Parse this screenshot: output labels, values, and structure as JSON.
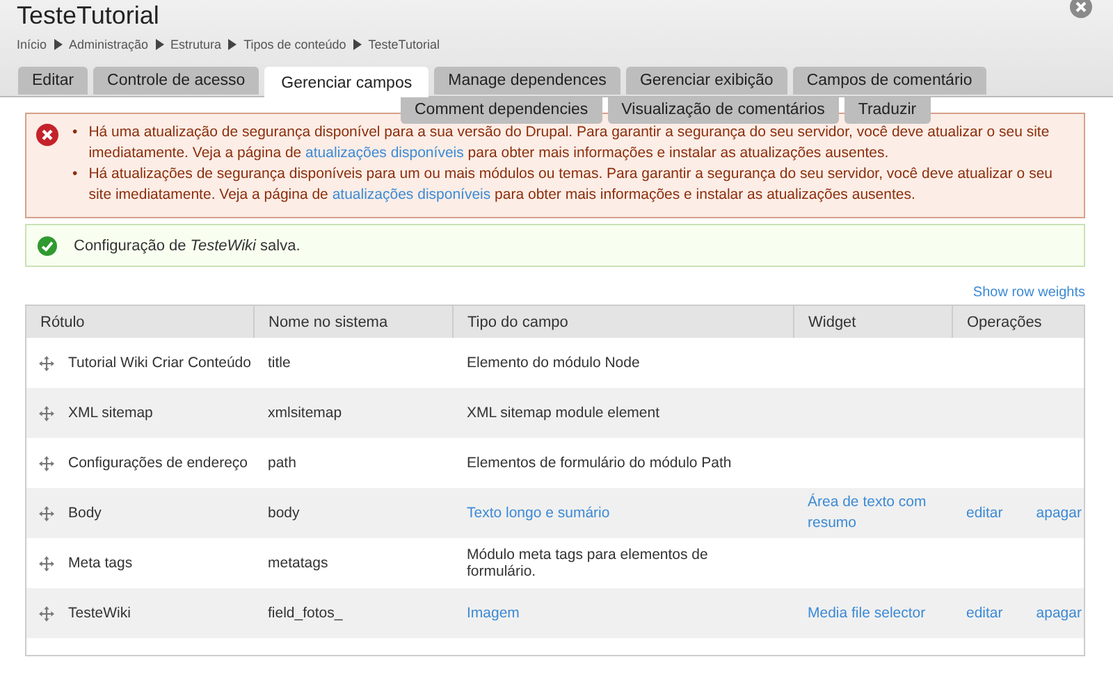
{
  "page": {
    "title": "TesteTutorial"
  },
  "breadcrumb": [
    "Início",
    "Administração",
    "Estrutura",
    "Tipos de conteúdo",
    "TesteTutorial"
  ],
  "tabs": [
    {
      "label": "Editar",
      "selected": false
    },
    {
      "label": "Controle de acesso",
      "selected": false
    },
    {
      "label": "Gerenciar campos",
      "selected": true
    },
    {
      "label": "Manage dependences",
      "selected": false
    },
    {
      "label": "Gerenciar exibição",
      "selected": false
    },
    {
      "label": "Campos de comentário",
      "selected": false
    }
  ],
  "secondary_tabs": [
    {
      "label": "Comment dependencies",
      "selected": false
    },
    {
      "label": "Visualização de comentários",
      "selected": false
    },
    {
      "label": "Traduzir",
      "selected": false
    }
  ],
  "error_message": {
    "marker": "•",
    "items": [
      {
        "text": "Há uma atualização de segurança disponível para a sua versão do Drupal. Para garantir a segurança do seu servidor, você deve atualizar o seu site imediatamente. Veja a página de",
        "link": "atualizações disponíveis",
        "after": "para obter mais informações e instalar as atualizações ausentes."
      },
      {
        "text": "Há atualizações de segurança disponíveis para um ou mais módulos ou temas. Para garantir a segurança do seu servidor, você deve atualizar o seu site imediatamente. Veja a página de",
        "link": "atualizações disponíveis",
        "after": "para obter mais informações e instalar as atualizações ausentes."
      }
    ]
  },
  "status_message": {
    "text": "Configuração de *TesteWiki* salva."
  },
  "show_row_weights": "Show row weights",
  "table": {
    "columns": [
      "Rótulo",
      "Nome no sistema",
      "Tipo do campo",
      "Widget",
      "Operações"
    ],
    "rows": [
      {
        "label": "Tutorial Wiki Criar Conteúdo",
        "machine_name": "title",
        "field_type": {
          "text": "Elemento do módulo Node",
          "link": false
        },
        "widget": "",
        "operations": []
      },
      {
        "label": "XML sitemap",
        "machine_name": "xmlsitemap",
        "field_type": {
          "text": "XML sitemap module element",
          "link": false
        },
        "widget": "",
        "operations": []
      },
      {
        "label": "Configurações de endereço",
        "machine_name": "path",
        "field_type": {
          "text": "Elementos de formulário do módulo Path",
          "link": false
        },
        "widget": "",
        "operations": []
      },
      {
        "label": "Body",
        "machine_name": "body",
        "field_type": {
          "text": "Texto longo e sumário",
          "link": true
        },
        "widget": "Área de texto com resumo",
        "operations": [
          "editar",
          "apagar"
        ]
      },
      {
        "label": "Meta tags",
        "machine_name": "metatags",
        "field_type": {
          "text": "Módulo meta tags para elementos de formulário.",
          "link": false
        },
        "widget": "",
        "operations": []
      },
      {
        "label": "TesteWiki",
        "machine_name": "field_fotos_",
        "field_type": {
          "text": "Imagem",
          "link": true
        },
        "widget": "Media file selector",
        "operations": [
          "editar",
          "apagar"
        ]
      }
    ]
  }
}
